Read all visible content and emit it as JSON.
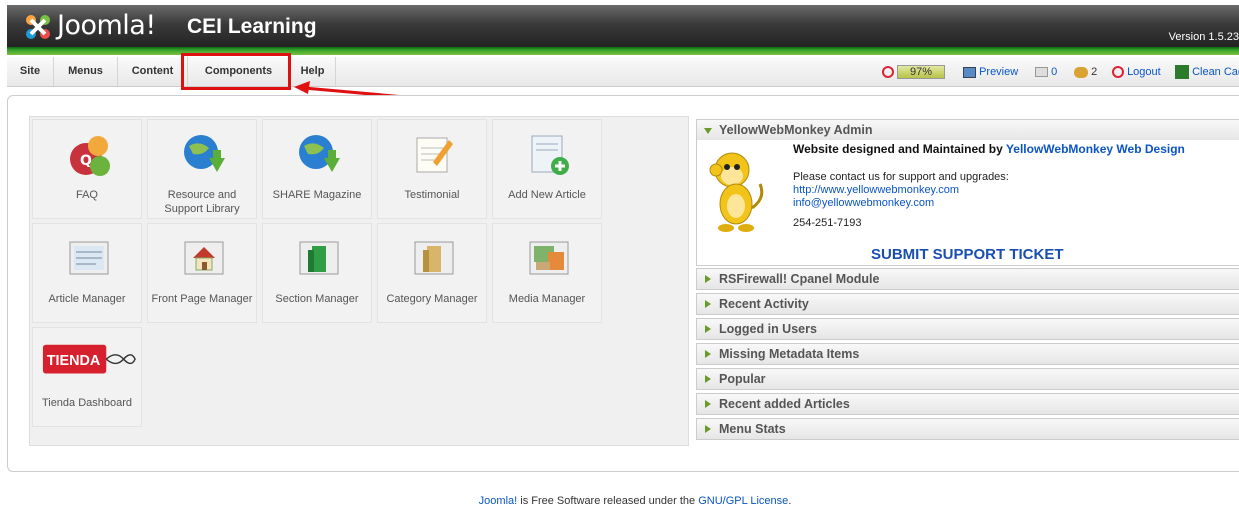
{
  "header": {
    "logo_text": "Joomla!",
    "site_name": "CEI Learning",
    "version": "Version 1.5.23"
  },
  "menu": {
    "items": [
      {
        "label": "Site"
      },
      {
        "label": "Menus"
      },
      {
        "label": "Content"
      },
      {
        "label": "Components"
      },
      {
        "label": "Help"
      }
    ],
    "highlighted": "Components"
  },
  "status": {
    "gauge": "97%",
    "preview": "Preview",
    "messages": "0",
    "users": "2",
    "logout": "Logout",
    "clean_cache": "Clean Cache"
  },
  "cpanel": {
    "tiles": [
      {
        "label": "FAQ",
        "icon": "faq-icon"
      },
      {
        "label": "Resource and Support Library",
        "icon": "globe-download-icon"
      },
      {
        "label": "SHARE Magazine",
        "icon": "globe-download-icon"
      },
      {
        "label": "Testimonial",
        "icon": "note-pencil-icon"
      },
      {
        "label": "Add New Article",
        "icon": "add-article-icon"
      },
      {
        "label": "Article Manager",
        "icon": "article-manager-icon"
      },
      {
        "label": "Front Page Manager",
        "icon": "home-icon"
      },
      {
        "label": "Section Manager",
        "icon": "section-icon"
      },
      {
        "label": "Category Manager",
        "icon": "category-icon"
      },
      {
        "label": "Media Manager",
        "icon": "media-icon"
      },
      {
        "label": "Tienda Dashboard",
        "icon": "tienda-logo"
      }
    ],
    "tienda_logo_text": "TIENDA"
  },
  "admin_module": {
    "title": "YellowWebMonkey Admin",
    "designed_prefix": "Website designed and Maintained by",
    "designed_link": "YellowWebMonkey Web Design",
    "contact": "Please contact us for support and upgrades:",
    "url": "http://www.yellowwebmonkey.com",
    "email": "info@yellowwebmonkey.com",
    "phone": "254-251-7193",
    "ticket": "SUBMIT SUPPORT TICKET"
  },
  "sliders": [
    {
      "label": "RSFirewall! Cpanel Module"
    },
    {
      "label": "Recent Activity"
    },
    {
      "label": "Logged in Users"
    },
    {
      "label": "Missing Metadata Items"
    },
    {
      "label": "Popular"
    },
    {
      "label": "Recent added Articles"
    },
    {
      "label": "Menu Stats"
    }
  ],
  "footer": {
    "brand": "Joomla!",
    "middle": " is Free Software released under the ",
    "license": "GNU/GPL License",
    "end": "."
  },
  "colors": {
    "accent_green": "#39a32c",
    "link_blue": "#0b55c4",
    "highlight_red": "#e01010"
  }
}
